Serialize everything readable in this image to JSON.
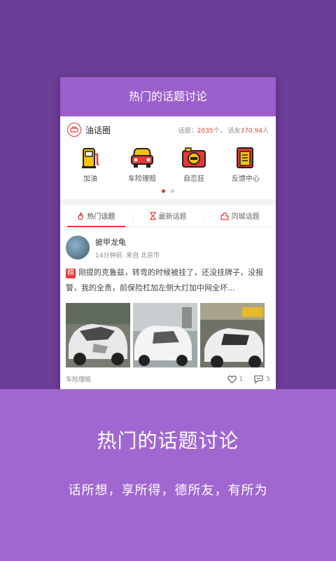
{
  "card": {
    "header_title": "热门的话题讨论",
    "circle_name": "油话圈",
    "stats": {
      "topics_label": "话题：",
      "topics_value": "2035",
      "topics_unit": "个，",
      "friends_label": "话友",
      "friends_value": "370.94",
      "friends_unit": "人"
    },
    "icons": [
      {
        "label": "加油",
        "icon": "fuel-pump-icon"
      },
      {
        "label": "车险理赔",
        "icon": "car-icon"
      },
      {
        "label": "自恋狂",
        "icon": "camera-icon"
      },
      {
        "label": "反馈中心",
        "icon": "document-icon"
      }
    ],
    "tabs": [
      {
        "label": "热门话题",
        "icon": "flame-icon"
      },
      {
        "label": "最新话题",
        "icon": "hourglass-icon"
      },
      {
        "label": "同城话题",
        "icon": "city-icon"
      }
    ],
    "post": {
      "author": "披甲龙龟",
      "time": "14分钟前",
      "from": "来自 北京市",
      "tag": "精",
      "text": "刚提的克鲁兹，转弯的时候被挂了，还没挂牌子，没报警，我的全责，前保险杠加左侧大灯加中网全坏...",
      "category": "车险理赔",
      "likes": "1",
      "comments": "5"
    }
  },
  "banner": {
    "title": "热门的话题讨论",
    "subtitle": "话所想，享所得，德所友，有所为"
  },
  "colors": {
    "background": "#6a3d96",
    "header": "#9b5fcc",
    "accent": "#e53935",
    "banner": "#a067d0"
  }
}
